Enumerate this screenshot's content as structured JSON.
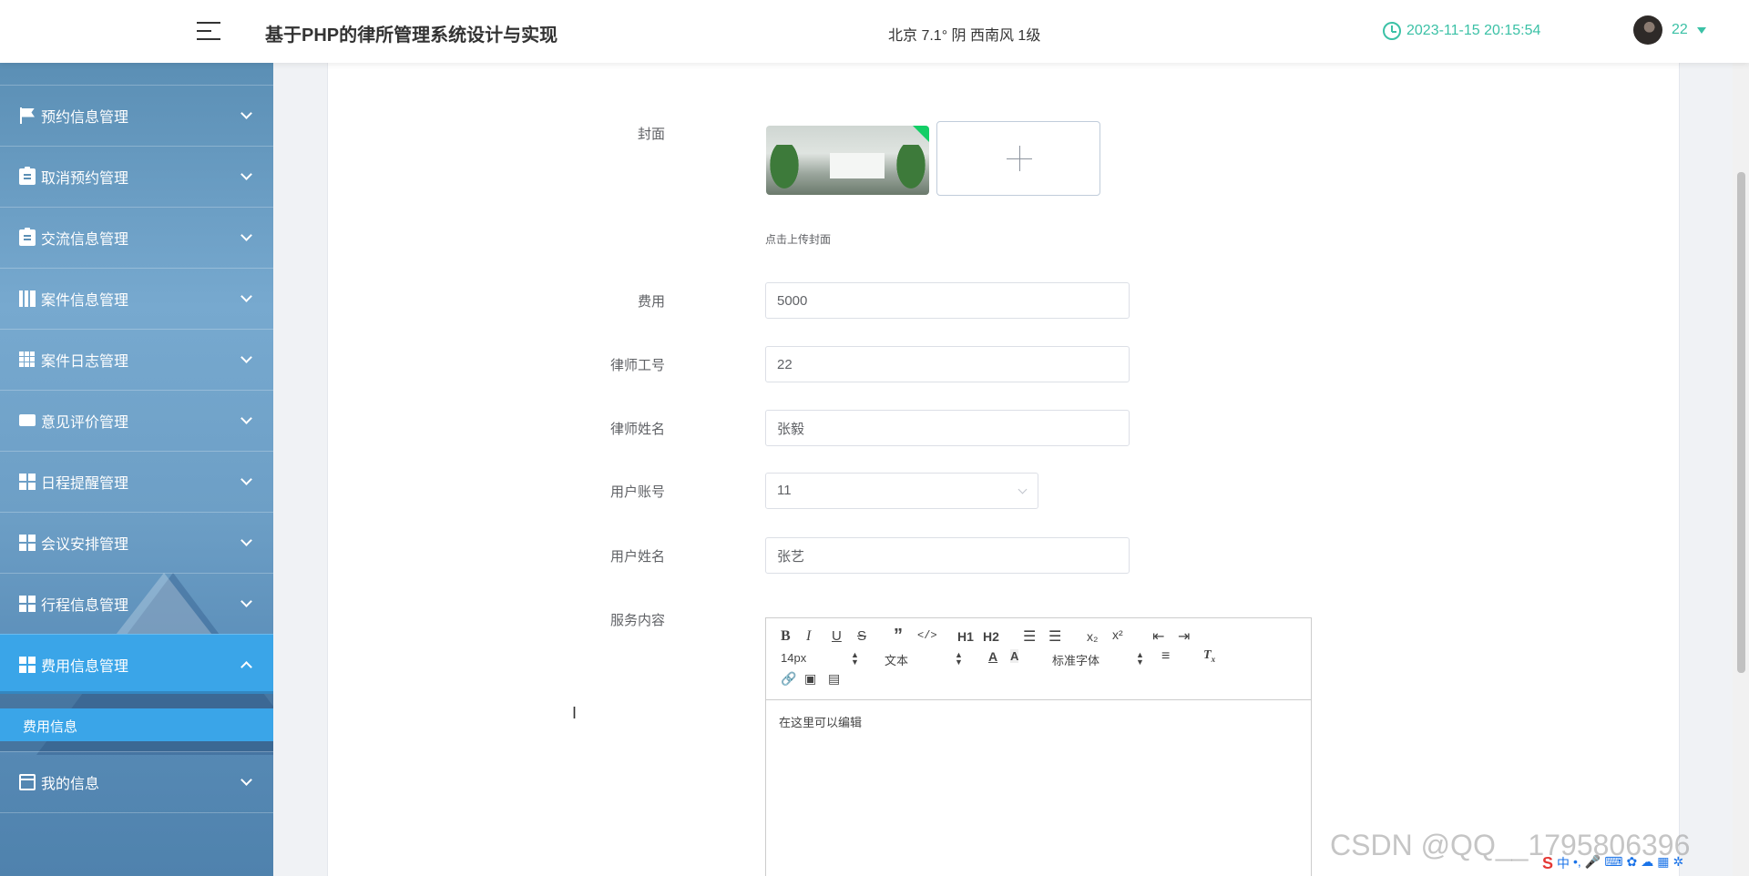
{
  "header": {
    "title": "基于PHP的律所管理系统设计与实现",
    "weather": "北京  7.1°  阴  西南风  1级",
    "datetime": "2023-11-15 20:15:54",
    "user_name": "22",
    "accent_color": "#3bc1a6"
  },
  "sidebar": {
    "items": [
      {
        "label": "预约信息管理",
        "icon": "flag-icon"
      },
      {
        "label": "取消预约管理",
        "icon": "clipboard-x-icon"
      },
      {
        "label": "交流信息管理",
        "icon": "clipboard-icon"
      },
      {
        "label": "案件信息管理",
        "icon": "books-icon"
      },
      {
        "label": "案件日志管理",
        "icon": "grid-icon"
      },
      {
        "label": "意见评价管理",
        "icon": "comment-icon"
      },
      {
        "label": "日程提醒管理",
        "icon": "dashboard-icon"
      },
      {
        "label": "会议安排管理",
        "icon": "dashboard-icon"
      },
      {
        "label": "行程信息管理",
        "icon": "dashboard-icon"
      },
      {
        "label": "费用信息管理",
        "icon": "dashboard-icon",
        "active": true
      },
      {
        "label": "我的信息",
        "icon": "wallet-icon"
      }
    ],
    "sub_item": "费用信息",
    "active_color": "#3aa5e8"
  },
  "form": {
    "cover_label": "封面",
    "cover_tip": "点击上传封面",
    "fee_label": "费用",
    "fee_value": "5000",
    "lawyer_id_label": "律师工号",
    "lawyer_id_value": "22",
    "lawyer_name_label": "律师姓名",
    "lawyer_name_value": "张毅",
    "user_account_label": "用户账号",
    "user_account_value": "11",
    "user_name_label": "用户姓名",
    "user_name_value": "张艺",
    "service_label": "服务内容"
  },
  "editor": {
    "font_size": "14px",
    "text_type": "文本",
    "font_family": "标准字体",
    "placeholder": "在这里可以编辑",
    "h1": "H1",
    "h2": "H2",
    "sub": "x₂",
    "sup": "x²",
    "bold": "B",
    "italic": "I",
    "underline": "U",
    "strike": "S"
  },
  "watermark": "CSDN @QQ__1795806396"
}
